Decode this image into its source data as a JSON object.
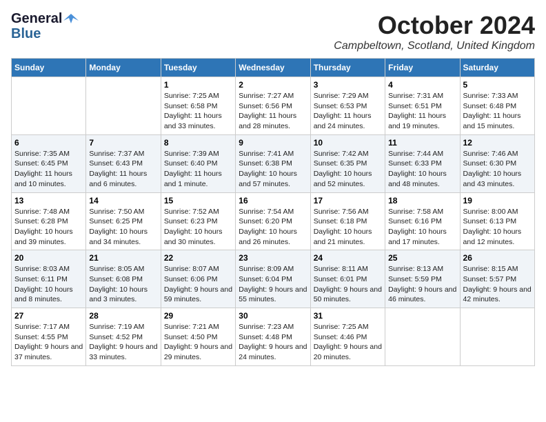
{
  "header": {
    "logo_line1": "General",
    "logo_line2": "Blue",
    "month": "October 2024",
    "location": "Campbeltown, Scotland, United Kingdom"
  },
  "days_of_week": [
    "Sunday",
    "Monday",
    "Tuesday",
    "Wednesday",
    "Thursday",
    "Friday",
    "Saturday"
  ],
  "weeks": [
    [
      {
        "day": "",
        "sunrise": "",
        "sunset": "",
        "daylight": ""
      },
      {
        "day": "",
        "sunrise": "",
        "sunset": "",
        "daylight": ""
      },
      {
        "day": "1",
        "sunrise": "Sunrise: 7:25 AM",
        "sunset": "Sunset: 6:58 PM",
        "daylight": "Daylight: 11 hours and 33 minutes."
      },
      {
        "day": "2",
        "sunrise": "Sunrise: 7:27 AM",
        "sunset": "Sunset: 6:56 PM",
        "daylight": "Daylight: 11 hours and 28 minutes."
      },
      {
        "day": "3",
        "sunrise": "Sunrise: 7:29 AM",
        "sunset": "Sunset: 6:53 PM",
        "daylight": "Daylight: 11 hours and 24 minutes."
      },
      {
        "day": "4",
        "sunrise": "Sunrise: 7:31 AM",
        "sunset": "Sunset: 6:51 PM",
        "daylight": "Daylight: 11 hours and 19 minutes."
      },
      {
        "day": "5",
        "sunrise": "Sunrise: 7:33 AM",
        "sunset": "Sunset: 6:48 PM",
        "daylight": "Daylight: 11 hours and 15 minutes."
      }
    ],
    [
      {
        "day": "6",
        "sunrise": "Sunrise: 7:35 AM",
        "sunset": "Sunset: 6:45 PM",
        "daylight": "Daylight: 11 hours and 10 minutes."
      },
      {
        "day": "7",
        "sunrise": "Sunrise: 7:37 AM",
        "sunset": "Sunset: 6:43 PM",
        "daylight": "Daylight: 11 hours and 6 minutes."
      },
      {
        "day": "8",
        "sunrise": "Sunrise: 7:39 AM",
        "sunset": "Sunset: 6:40 PM",
        "daylight": "Daylight: 11 hours and 1 minute."
      },
      {
        "day": "9",
        "sunrise": "Sunrise: 7:41 AM",
        "sunset": "Sunset: 6:38 PM",
        "daylight": "Daylight: 10 hours and 57 minutes."
      },
      {
        "day": "10",
        "sunrise": "Sunrise: 7:42 AM",
        "sunset": "Sunset: 6:35 PM",
        "daylight": "Daylight: 10 hours and 52 minutes."
      },
      {
        "day": "11",
        "sunrise": "Sunrise: 7:44 AM",
        "sunset": "Sunset: 6:33 PM",
        "daylight": "Daylight: 10 hours and 48 minutes."
      },
      {
        "day": "12",
        "sunrise": "Sunrise: 7:46 AM",
        "sunset": "Sunset: 6:30 PM",
        "daylight": "Daylight: 10 hours and 43 minutes."
      }
    ],
    [
      {
        "day": "13",
        "sunrise": "Sunrise: 7:48 AM",
        "sunset": "Sunset: 6:28 PM",
        "daylight": "Daylight: 10 hours and 39 minutes."
      },
      {
        "day": "14",
        "sunrise": "Sunrise: 7:50 AM",
        "sunset": "Sunset: 6:25 PM",
        "daylight": "Daylight: 10 hours and 34 minutes."
      },
      {
        "day": "15",
        "sunrise": "Sunrise: 7:52 AM",
        "sunset": "Sunset: 6:23 PM",
        "daylight": "Daylight: 10 hours and 30 minutes."
      },
      {
        "day": "16",
        "sunrise": "Sunrise: 7:54 AM",
        "sunset": "Sunset: 6:20 PM",
        "daylight": "Daylight: 10 hours and 26 minutes."
      },
      {
        "day": "17",
        "sunrise": "Sunrise: 7:56 AM",
        "sunset": "Sunset: 6:18 PM",
        "daylight": "Daylight: 10 hours and 21 minutes."
      },
      {
        "day": "18",
        "sunrise": "Sunrise: 7:58 AM",
        "sunset": "Sunset: 6:16 PM",
        "daylight": "Daylight: 10 hours and 17 minutes."
      },
      {
        "day": "19",
        "sunrise": "Sunrise: 8:00 AM",
        "sunset": "Sunset: 6:13 PM",
        "daylight": "Daylight: 10 hours and 12 minutes."
      }
    ],
    [
      {
        "day": "20",
        "sunrise": "Sunrise: 8:03 AM",
        "sunset": "Sunset: 6:11 PM",
        "daylight": "Daylight: 10 hours and 8 minutes."
      },
      {
        "day": "21",
        "sunrise": "Sunrise: 8:05 AM",
        "sunset": "Sunset: 6:08 PM",
        "daylight": "Daylight: 10 hours and 3 minutes."
      },
      {
        "day": "22",
        "sunrise": "Sunrise: 8:07 AM",
        "sunset": "Sunset: 6:06 PM",
        "daylight": "Daylight: 9 hours and 59 minutes."
      },
      {
        "day": "23",
        "sunrise": "Sunrise: 8:09 AM",
        "sunset": "Sunset: 6:04 PM",
        "daylight": "Daylight: 9 hours and 55 minutes."
      },
      {
        "day": "24",
        "sunrise": "Sunrise: 8:11 AM",
        "sunset": "Sunset: 6:01 PM",
        "daylight": "Daylight: 9 hours and 50 minutes."
      },
      {
        "day": "25",
        "sunrise": "Sunrise: 8:13 AM",
        "sunset": "Sunset: 5:59 PM",
        "daylight": "Daylight: 9 hours and 46 minutes."
      },
      {
        "day": "26",
        "sunrise": "Sunrise: 8:15 AM",
        "sunset": "Sunset: 5:57 PM",
        "daylight": "Daylight: 9 hours and 42 minutes."
      }
    ],
    [
      {
        "day": "27",
        "sunrise": "Sunrise: 7:17 AM",
        "sunset": "Sunset: 4:55 PM",
        "daylight": "Daylight: 9 hours and 37 minutes."
      },
      {
        "day": "28",
        "sunrise": "Sunrise: 7:19 AM",
        "sunset": "Sunset: 4:52 PM",
        "daylight": "Daylight: 9 hours and 33 minutes."
      },
      {
        "day": "29",
        "sunrise": "Sunrise: 7:21 AM",
        "sunset": "Sunset: 4:50 PM",
        "daylight": "Daylight: 9 hours and 29 minutes."
      },
      {
        "day": "30",
        "sunrise": "Sunrise: 7:23 AM",
        "sunset": "Sunset: 4:48 PM",
        "daylight": "Daylight: 9 hours and 24 minutes."
      },
      {
        "day": "31",
        "sunrise": "Sunrise: 7:25 AM",
        "sunset": "Sunset: 4:46 PM",
        "daylight": "Daylight: 9 hours and 20 minutes."
      },
      {
        "day": "",
        "sunrise": "",
        "sunset": "",
        "daylight": ""
      },
      {
        "day": "",
        "sunrise": "",
        "sunset": "",
        "daylight": ""
      }
    ]
  ]
}
